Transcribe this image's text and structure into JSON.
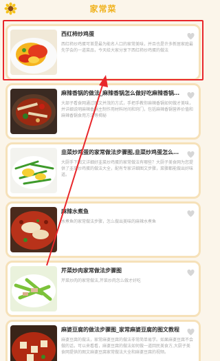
{
  "header": {
    "title": "家常菜",
    "logo_icon": "sunflower-icon"
  },
  "recipes": [
    {
      "title": "西红柿炒鸡蛋",
      "desc": "西红柿炒鸡蛋可首是最为能名人口的家常美味，并且也是许多新居家庭最先学会的一道菜品，今天给大家分享下西红柿炒鸡蛋的做法",
      "favorite_icon": "heart-icon"
    },
    {
      "title": "麻辣香锅的做法_麻辣香锅怎么做好吃麻辣香锅的...",
      "desc": "大部子看食网通过图文并茂的方式，手把手教你麻辣香锅如何做才美味，并详细说明麻辣香锅主制作用材料时间和窍门，包括麻辣香锅营养价值和麻辣香锅食用方法等揭秘",
      "favorite_icon": "heart-icon"
    },
    {
      "title": "韭菜炒鸡蛋的家常做法步骤图,韭菜炒鸡蛋怎么做...",
      "desc": "大厨手下图文详细好韭菜炒鸡蛋的家常做法有哪些？大厨子美食网为您提供了韭菜炒鸡蛋的做法大全，配有专家详细图文步骤，菜骤都能做出好味道。",
      "favorite_icon": "heart-icon"
    },
    {
      "title": "麻辣水煮鱼",
      "desc": "水煮鱼的家常做法步骤，怎么做出美味的麻辣水煮鱼",
      "favorite_icon": "heart-icon"
    },
    {
      "title": "芹菜炒肉家常做法步骤图",
      "desc": "芹菜炒肉的家常做法,芹菜炒肉怎么做才好吃",
      "favorite_icon": "heart-icon"
    },
    {
      "title": "麻婆豆腐的做法步骤图_家常麻婆豆腐的图文教程",
      "desc": "麻婆豆腐的做法，家常麻婆豆腐的做法非常简单易学。如果麻婆豆腐不会做的话，可以来看看，麻婆豆腐的做法如何做一道回民美食方,大厨子美食网提供的图文麻婆豆腐家常做法大全和麻婆豆腐的视频。",
      "favorite_icon": "heart-icon"
    }
  ]
}
